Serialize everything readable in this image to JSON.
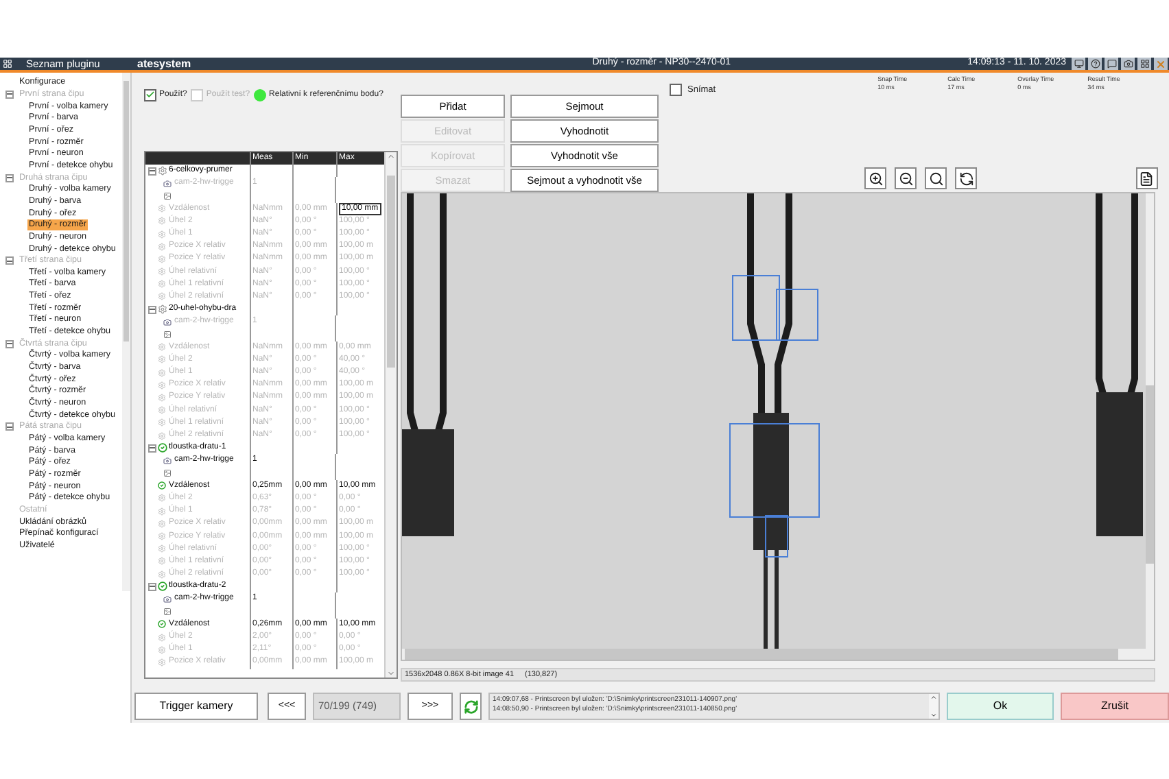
{
  "window": {
    "sidebar_title": "Seznam pluginu",
    "logo": "atesystem",
    "title": "Druhý - rozměr - NP30--2470-01",
    "clock": "14:09:13 - 11. 10. 2023"
  },
  "sidebar": {
    "items": [
      {
        "label": "Konfigurace",
        "disabled": false,
        "selected": false
      },
      {
        "label": "První strana čipu",
        "disabled": true,
        "selected": false,
        "expanded": true,
        "children": [
          {
            "label": "První - volba kamery",
            "disabled": false,
            "selected": false
          },
          {
            "label": "První - barva",
            "disabled": false,
            "selected": false
          },
          {
            "label": "První - ořez",
            "disabled": false,
            "selected": false
          },
          {
            "label": "První - rozměr",
            "disabled": false,
            "selected": false
          },
          {
            "label": "První - neuron",
            "disabled": false,
            "selected": false
          },
          {
            "label": "První - detekce ohybu",
            "disabled": false,
            "selected": false
          }
        ]
      },
      {
        "label": "Druhá strana čipu",
        "disabled": true,
        "selected": false,
        "expanded": true,
        "children": [
          {
            "label": "Druhý - volba kamery",
            "disabled": false,
            "selected": false
          },
          {
            "label": "Druhý - barva",
            "disabled": false,
            "selected": false
          },
          {
            "label": "Druhý - ořez",
            "disabled": false,
            "selected": false
          },
          {
            "label": "Druhý - rozměr",
            "disabled": false,
            "selected": true
          },
          {
            "label": "Druhý - neuron",
            "disabled": false,
            "selected": false
          },
          {
            "label": "Druhý - detekce ohybu",
            "disabled": false,
            "selected": false
          }
        ]
      },
      {
        "label": "Třetí strana čipu",
        "disabled": true,
        "selected": false,
        "expanded": true,
        "children": [
          {
            "label": "Třetí - volba kamery",
            "disabled": false,
            "selected": false
          },
          {
            "label": "Třetí - barva",
            "disabled": false,
            "selected": false
          },
          {
            "label": "Třetí - ořez",
            "disabled": false,
            "selected": false
          },
          {
            "label": "Třetí - rozměr",
            "disabled": false,
            "selected": false
          },
          {
            "label": "Třetí - neuron",
            "disabled": false,
            "selected": false
          },
          {
            "label": "Třetí - detekce ohybu",
            "disabled": false,
            "selected": false
          }
        ]
      },
      {
        "label": "Čtvrtá strana čipu",
        "disabled": true,
        "selected": false,
        "expanded": true,
        "children": [
          {
            "label": "Čtvrtý - volba kamery",
            "disabled": false,
            "selected": false
          },
          {
            "label": "Čtvrtý - barva",
            "disabled": false,
            "selected": false
          },
          {
            "label": "Čtvrtý - ořez",
            "disabled": false,
            "selected": false
          },
          {
            "label": "Čtvrtý - rozměr",
            "disabled": false,
            "selected": false
          },
          {
            "label": "Čtvrtý - neuron",
            "disabled": false,
            "selected": false
          },
          {
            "label": "Čtvrtý - detekce ohybu",
            "disabled": false,
            "selected": false
          }
        ]
      },
      {
        "label": "Pátá strana čipu",
        "disabled": true,
        "selected": false,
        "expanded": true,
        "children": [
          {
            "label": "Pátý - volba kamery",
            "disabled": false,
            "selected": false
          },
          {
            "label": "Pátý - barva",
            "disabled": false,
            "selected": false
          },
          {
            "label": "Pátý - ořez",
            "disabled": false,
            "selected": false
          },
          {
            "label": "Pátý - rozměr",
            "disabled": false,
            "selected": false
          },
          {
            "label": "Pátý - neuron",
            "disabled": false,
            "selected": false
          },
          {
            "label": "Pátý - detekce ohybu",
            "disabled": false,
            "selected": false
          }
        ]
      },
      {
        "label": "Ostatní",
        "disabled": true,
        "selected": false
      },
      {
        "label": "Ukládání obrázků",
        "disabled": false,
        "selected": false
      },
      {
        "label": "Přepínač konfigurací",
        "disabled": false,
        "selected": false
      },
      {
        "label": "Uživatelé",
        "disabled": false,
        "selected": false
      }
    ]
  },
  "options": [
    {
      "kind": "checkbox",
      "label": "Použít?",
      "checked": true,
      "disabled": false
    },
    {
      "kind": "checkbox",
      "label": "Použít test?",
      "checked": false,
      "disabled": true
    },
    {
      "kind": "indicator",
      "label": "Relativní k referenčnímu bodu?",
      "on": true
    }
  ],
  "table": {
    "columns": [
      "Meas",
      "Min",
      "Max"
    ],
    "groups": [
      {
        "name": "6-celkovy-prumer",
        "passed": false,
        "expanded": true,
        "rows": [
          {
            "kind": "camera",
            "name": "cam-2-hw-trigge",
            "meas": "1",
            "active": false
          },
          {
            "kind": "image"
          },
          {
            "kind": "measure",
            "name": "Vzdálenost",
            "meas": "NaNmm",
            "min": "0,00 mm",
            "max": "10,00 mm",
            "active": false,
            "editing": true
          },
          {
            "kind": "measure",
            "name": "Úhel 2",
            "meas": "NaN°",
            "min": "0,00 °",
            "max": "100,00 °",
            "active": false,
            "editing": false
          },
          {
            "kind": "measure",
            "name": "Úhel 1",
            "meas": "NaN°",
            "min": "0,00 °",
            "max": "100,00 °",
            "active": false,
            "editing": false
          },
          {
            "kind": "measure",
            "name": "Pozice X relativ",
            "meas": "NaNmm",
            "min": "0,00 mm",
            "max": "100,00 m",
            "active": false,
            "editing": false
          },
          {
            "kind": "measure",
            "name": "Pozice Y relativ",
            "meas": "NaNmm",
            "min": "0,00 mm",
            "max": "100,00 m",
            "active": false,
            "editing": false
          },
          {
            "kind": "measure",
            "name": "Úhel relativní",
            "meas": "NaN°",
            "min": "0,00 °",
            "max": "100,00 °",
            "active": false,
            "editing": false
          },
          {
            "kind": "measure",
            "name": "Úhel 1 relativní",
            "meas": "NaN°",
            "min": "0,00 °",
            "max": "100,00 °",
            "active": false,
            "editing": false
          },
          {
            "kind": "measure",
            "name": "Úhel 2 relativní",
            "meas": "NaN°",
            "min": "0,00 °",
            "max": "100,00 °",
            "active": false,
            "editing": false
          }
        ]
      },
      {
        "name": "20-uhel-ohybu-dra",
        "passed": false,
        "expanded": true,
        "rows": [
          {
            "kind": "camera",
            "name": "cam-2-hw-trigge",
            "meas": "1",
            "active": false
          },
          {
            "kind": "image"
          },
          {
            "kind": "measure",
            "name": "Vzdálenost",
            "meas": "NaNmm",
            "min": "0,00 mm",
            "max": "0,00 mm",
            "active": false,
            "editing": false
          },
          {
            "kind": "measure",
            "name": "Úhel 2",
            "meas": "NaN°",
            "min": "0,00 °",
            "max": "40,00 °",
            "active": false,
            "editing": false
          },
          {
            "kind": "measure",
            "name": "Úhel 1",
            "meas": "NaN°",
            "min": "0,00 °",
            "max": "40,00 °",
            "active": false,
            "editing": false
          },
          {
            "kind": "measure",
            "name": "Pozice X relativ",
            "meas": "NaNmm",
            "min": "0,00 mm",
            "max": "100,00 m",
            "active": false,
            "editing": false
          },
          {
            "kind": "measure",
            "name": "Pozice Y relativ",
            "meas": "NaNmm",
            "min": "0,00 mm",
            "max": "100,00 m",
            "active": false,
            "editing": false
          },
          {
            "kind": "measure",
            "name": "Úhel relativní",
            "meas": "NaN°",
            "min": "0,00 °",
            "max": "100,00 °",
            "active": false,
            "editing": false
          },
          {
            "kind": "measure",
            "name": "Úhel 1 relativní",
            "meas": "NaN°",
            "min": "0,00 °",
            "max": "100,00 °",
            "active": false,
            "editing": false
          },
          {
            "kind": "measure",
            "name": "Úhel 2 relativní",
            "meas": "NaN°",
            "min": "0,00 °",
            "max": "100,00 °",
            "active": false,
            "editing": false
          }
        ]
      },
      {
        "name": "tloustka-dratu-1",
        "passed": true,
        "expanded": true,
        "rows": [
          {
            "kind": "camera",
            "name": "cam-2-hw-trigge",
            "meas": "1",
            "active": true
          },
          {
            "kind": "image"
          },
          {
            "kind": "measure",
            "name": "Vzdálenost",
            "meas": "0,25mm",
            "min": "0,00 mm",
            "max": "10,00 mm",
            "active": true,
            "editing": false
          },
          {
            "kind": "measure",
            "name": "Úhel 2",
            "meas": "0,63°",
            "min": "0,00 °",
            "max": "0,00 °",
            "active": false,
            "editing": false
          },
          {
            "kind": "measure",
            "name": "Úhel 1",
            "meas": "0,78°",
            "min": "0,00 °",
            "max": "0,00 °",
            "active": false,
            "editing": false
          },
          {
            "kind": "measure",
            "name": "Pozice X relativ",
            "meas": "0,00mm",
            "min": "0,00 mm",
            "max": "100,00 m",
            "active": false,
            "editing": false
          },
          {
            "kind": "measure",
            "name": "Pozice Y relativ",
            "meas": "0,00mm",
            "min": "0,00 mm",
            "max": "100,00 m",
            "active": false,
            "editing": false
          },
          {
            "kind": "measure",
            "name": "Úhel relativní",
            "meas": "0,00°",
            "min": "0,00 °",
            "max": "100,00 °",
            "active": false,
            "editing": false
          },
          {
            "kind": "measure",
            "name": "Úhel 1 relativní",
            "meas": "0,00°",
            "min": "0,00 °",
            "max": "100,00 °",
            "active": false,
            "editing": false
          },
          {
            "kind": "measure",
            "name": "Úhel 2 relativní",
            "meas": "0,00°",
            "min": "0,00 °",
            "max": "100,00 °",
            "active": false,
            "editing": false
          }
        ]
      },
      {
        "name": "tloustka-dratu-2",
        "passed": true,
        "expanded": true,
        "rows": [
          {
            "kind": "camera",
            "name": "cam-2-hw-trigge",
            "meas": "1",
            "active": true
          },
          {
            "kind": "image"
          },
          {
            "kind": "measure",
            "name": "Vzdálenost",
            "meas": "0,26mm",
            "min": "0,00 mm",
            "max": "10,00 mm",
            "active": true,
            "editing": false
          },
          {
            "kind": "measure",
            "name": "Úhel 2",
            "meas": "2,00°",
            "min": "0,00 °",
            "max": "0,00 °",
            "active": false,
            "editing": false
          },
          {
            "kind": "measure",
            "name": "Úhel 1",
            "meas": "2,11°",
            "min": "0,00 °",
            "max": "0,00 °",
            "active": false,
            "editing": false
          },
          {
            "kind": "measure",
            "name": "Pozice X relativ",
            "meas": "0,00mm",
            "min": "0,00 mm",
            "max": "100,00 m",
            "active": false,
            "editing": false
          }
        ]
      }
    ]
  },
  "buttons": [
    {
      "label": "Přidat",
      "disabled": false
    },
    {
      "label": "Sejmout",
      "disabled": false
    },
    {
      "label": "Editovat",
      "disabled": true
    },
    {
      "label": "Vyhodnotit",
      "disabled": false
    },
    {
      "label": "Kopírovat",
      "disabled": true
    },
    {
      "label": "Vyhodnotit vše",
      "disabled": false
    },
    {
      "label": "Smazat",
      "disabled": true
    },
    {
      "label": "Sejmout a vyhodnotit vše",
      "disabled": false
    }
  ],
  "capture": {
    "label": "Snímat",
    "checked": false
  },
  "timings": [
    {
      "label": "Snap Time",
      "value": "10 ms"
    },
    {
      "label": "Calc Time",
      "value": "17 ms"
    },
    {
      "label": "Overlay Time",
      "value": "0 ms"
    },
    {
      "label": "Result Time",
      "value": "34 ms"
    }
  ],
  "status_bar": {
    "image_info": "1536x2048 0.86X 8-bit image 41",
    "cursor": "(130,827)"
  },
  "bottom": {
    "trigger": "Trigger kamery",
    "prev": "<<<",
    "counter": "70/199 (749)",
    "next": ">>>",
    "log": [
      "14:09:07,68 - Printscreen byl uložen: 'D:\\Snimky\\printscreen231011-140907.png'",
      "14:08:50,90 - Printscreen byl uložen: 'D:\\Snimky\\printscreen231011-140850.png'"
    ],
    "ok": "Ok",
    "cancel": "Zrušit"
  }
}
